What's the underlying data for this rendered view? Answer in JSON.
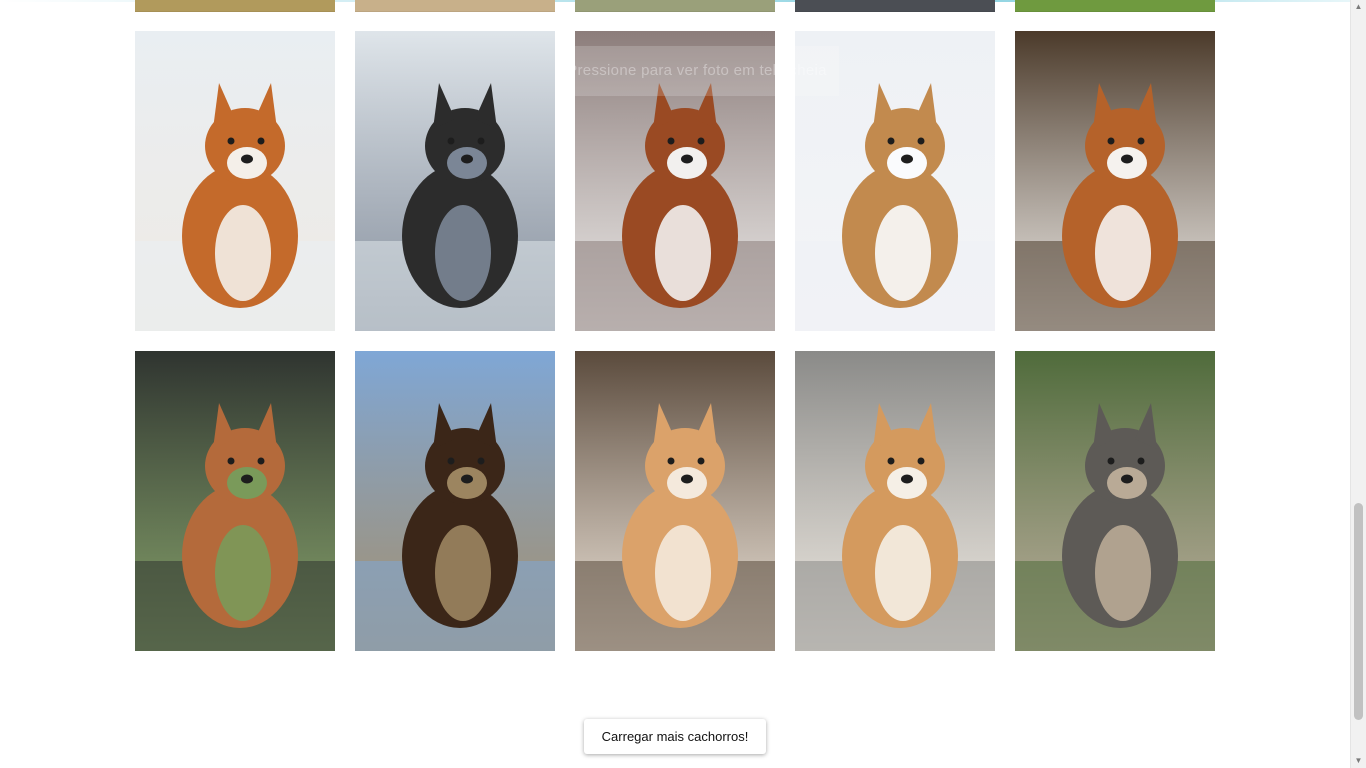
{
  "gallery": {
    "overlay_text": "Pressione para ver foto em tela cheia",
    "load_more_label": "Carregar mais cachorros!"
  },
  "photos": [
    {
      "name": "siberian-husky-pair-photo",
      "colors": [
        "#e9eef2",
        "#c46a2b",
        "#f4efe9"
      ]
    },
    {
      "name": "border-collie-beware-of-dog-photo",
      "colors": [
        "#dfe5ea",
        "#2c2c2c",
        "#7b8696"
      ]
    },
    {
      "name": "cocker-spaniel-on-blanket-photo",
      "colors": [
        "#8c7d7b",
        "#9a4a23",
        "#f2f0ee"
      ]
    },
    {
      "name": "puppy-in-snow-photo",
      "colors": [
        "#eef1f5",
        "#c28a4e",
        "#fafbfd"
      ]
    },
    {
      "name": "kooikerhondje-on-grass-photo",
      "colors": [
        "#4b3a2a",
        "#b5622a",
        "#f5f2ee"
      ]
    },
    {
      "name": "saint-bernard-puppy-on-truck-photo",
      "colors": [
        "#2f3430",
        "#b46a3b",
        "#7a9a5a"
      ]
    },
    {
      "name": "saint-bernard-in-field-photo",
      "colors": [
        "#7fa7d6",
        "#3b2618",
        "#9c8560"
      ]
    },
    {
      "name": "shiba-inu-on-bench-photo",
      "colors": [
        "#5a4a3c",
        "#dba26a",
        "#f4e9dc"
      ]
    },
    {
      "name": "shiba-inu-in-sweater-photo",
      "colors": [
        "#8a8a88",
        "#d49a5e",
        "#f5efe6"
      ]
    },
    {
      "name": "schnauzer-on-rock-photo",
      "colors": [
        "#4f6b3b",
        "#5d5a56",
        "#b9aa96"
      ]
    }
  ],
  "top_strips": [
    "#b19a5c",
    "#c8b08a",
    "#9aa07a",
    "#4b4e54",
    "#6f9a3f"
  ]
}
